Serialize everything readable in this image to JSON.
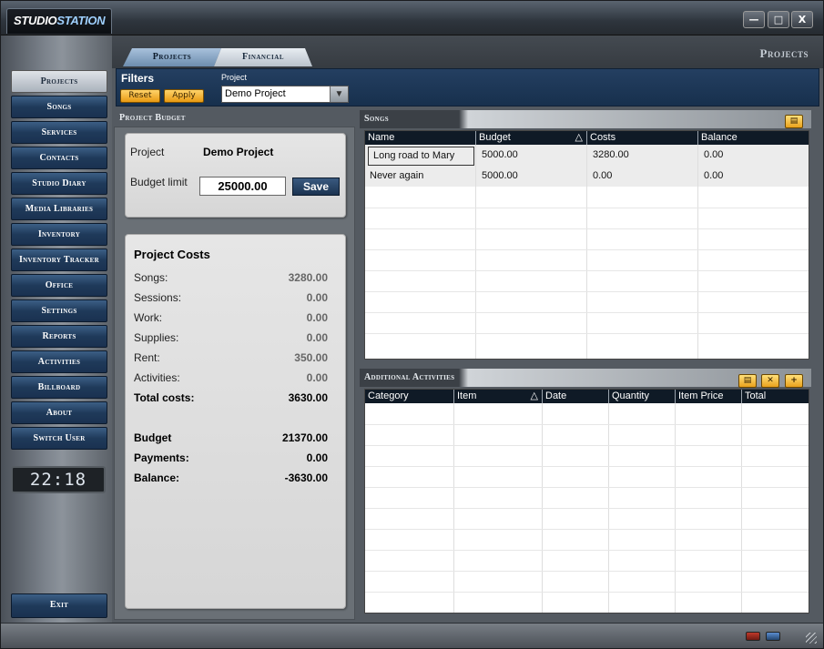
{
  "app": {
    "logo_a": "STUDIO",
    "logo_b": "STATION",
    "page_title": "Projects"
  },
  "window_controls": {
    "minimize": "—",
    "maximize": "□",
    "close": "X"
  },
  "sidebar": {
    "items": [
      {
        "label": "Projects"
      },
      {
        "label": "Songs"
      },
      {
        "label": "Services"
      },
      {
        "label": "Contacts"
      },
      {
        "label": "Studio Diary"
      },
      {
        "label": "Media Libraries"
      },
      {
        "label": "Inventory"
      },
      {
        "label": "Inventory Tracker"
      },
      {
        "label": "Office"
      },
      {
        "label": "Settings"
      },
      {
        "label": "Reports"
      },
      {
        "label": "Activities"
      },
      {
        "label": "Billboard"
      },
      {
        "label": "About"
      },
      {
        "label": "Switch User"
      }
    ],
    "active_index": 0,
    "clock": "22:18",
    "exit_label": "Exit"
  },
  "tabs": [
    {
      "label": "Projects"
    },
    {
      "label": "Financial"
    }
  ],
  "filters": {
    "title": "Filters",
    "reset_label": "Reset",
    "apply_label": "Apply",
    "project_label": "Project",
    "project_value": "Demo Project",
    "dropdown_arrow": "▼"
  },
  "project_budget": {
    "heading": "Project Budget",
    "project_label": "Project",
    "project_value": "Demo Project",
    "budget_limit_label": "Budget limit",
    "budget_limit_value": "25000.00",
    "save_label": "Save",
    "costs_title": "Project Costs",
    "costs": [
      {
        "name": "Songs:",
        "value": "3280.00"
      },
      {
        "name": "Sessions:",
        "value": "0.00"
      },
      {
        "name": "Work:",
        "value": "0.00"
      },
      {
        "name": "Supplies:",
        "value": "0.00"
      },
      {
        "name": "Rent:",
        "value": "350.00"
      },
      {
        "name": "Activities:",
        "value": "0.00"
      },
      {
        "name": "Total costs:",
        "value": "3630.00"
      }
    ],
    "summary": [
      {
        "name": "Budget",
        "value": "21370.00"
      },
      {
        "name": "Payments:",
        "value": "0.00"
      },
      {
        "name": "Balance:",
        "value": "-3630.00"
      }
    ]
  },
  "songs": {
    "heading": "Songs",
    "columns": [
      "Name",
      "Budget",
      "Costs",
      "Balance"
    ],
    "sort_indicator": "△",
    "rows": [
      [
        "Long road to Mary",
        "5000.00",
        "3280.00",
        "0.00"
      ],
      [
        "Never again",
        "5000.00",
        "0.00",
        "0.00"
      ]
    ]
  },
  "activities": {
    "heading": "Additional Activities",
    "columns": [
      "Category",
      "Item",
      "Date",
      "Quantity",
      "Item Price",
      "Total"
    ],
    "sort_indicator": "△"
  },
  "colors": {
    "accent_orange": "#e89a12",
    "nav_blue": "#1f3a5a",
    "header_dark": "#0f1a26"
  }
}
